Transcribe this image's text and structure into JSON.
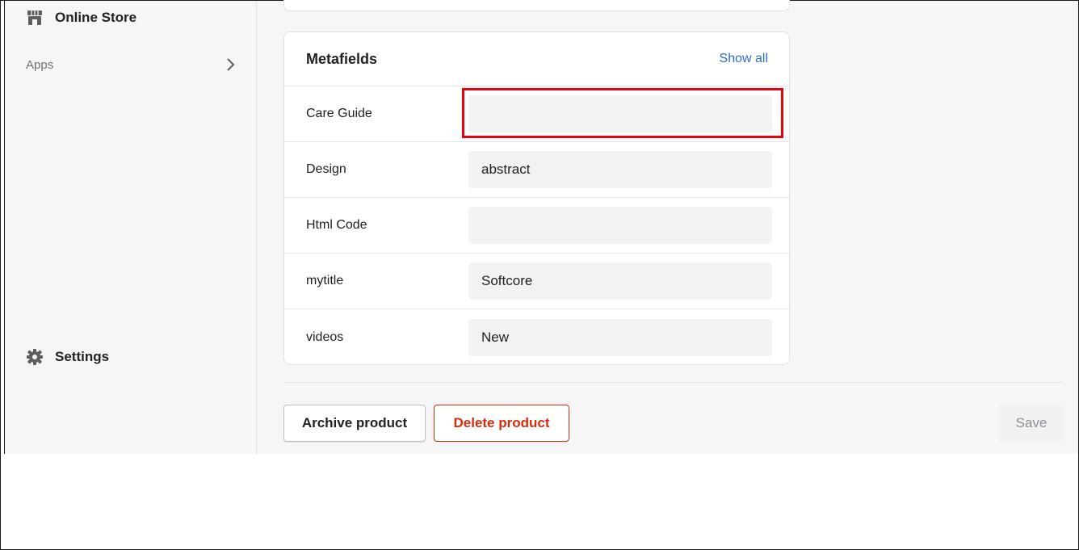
{
  "sidebar": {
    "online_store_label": "Online Store",
    "apps_label": "Apps",
    "settings_label": "Settings"
  },
  "metafields": {
    "title": "Metafields",
    "show_all": "Show all",
    "rows": [
      {
        "label": "Care Guide",
        "value": ""
      },
      {
        "label": "Design",
        "value": "abstract"
      },
      {
        "label": "Html Code",
        "value": ""
      },
      {
        "label": "mytitle",
        "value": "Softcore"
      },
      {
        "label": "videos",
        "value": "New"
      }
    ]
  },
  "actions": {
    "archive_label": "Archive product",
    "delete_label": "Delete product",
    "save_label": "Save"
  },
  "colors": {
    "highlight": "#e8000b",
    "link": "#2c6ecb",
    "danger": "#d82c0d"
  }
}
